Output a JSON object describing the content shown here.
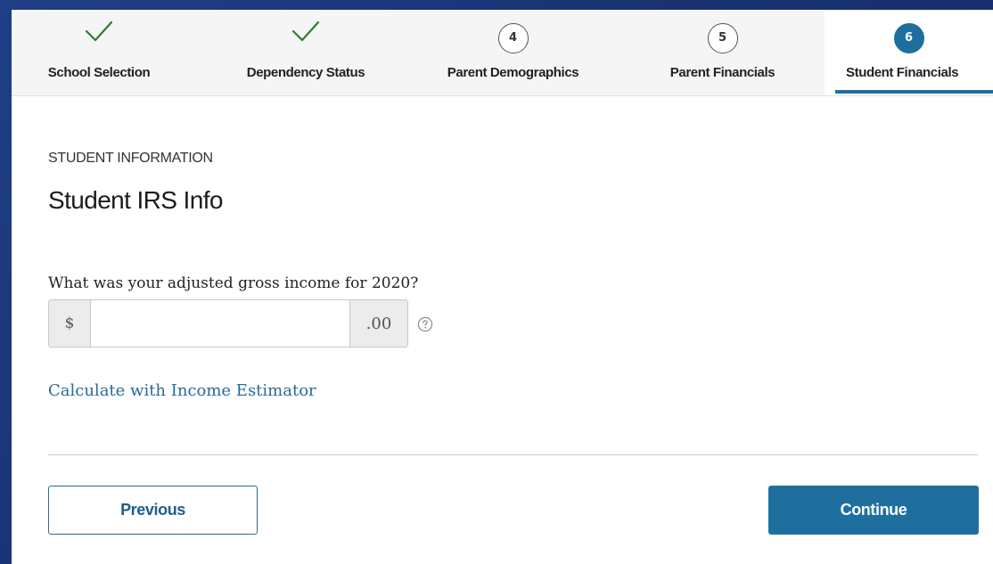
{
  "stepper": {
    "steps": [
      {
        "label": "School Selection",
        "status": "complete",
        "icon": "checkmark-icon"
      },
      {
        "label": "Dependency Status",
        "status": "complete",
        "icon": "checkmark-icon"
      },
      {
        "label": "Parent Demographics",
        "status": "upcoming",
        "number": "4"
      },
      {
        "label": "Parent Financials",
        "status": "upcoming",
        "number": "5"
      },
      {
        "label": "Student Financials",
        "status": "active",
        "number": "6"
      }
    ],
    "colors": {
      "complete": "#2e7d32",
      "active": "#1f6f9e"
    }
  },
  "content": {
    "eyebrow": "STUDENT INFORMATION",
    "title": "Student IRS Info",
    "question": "What was your adjusted gross income for 2020?",
    "income": {
      "prefix": "$",
      "suffix": ".00",
      "value": "",
      "help_icon": "question-circle-icon"
    },
    "estimator_link": "Calculate with Income Estimator"
  },
  "actions": {
    "previous_label": "Previous",
    "continue_label": "Continue"
  }
}
